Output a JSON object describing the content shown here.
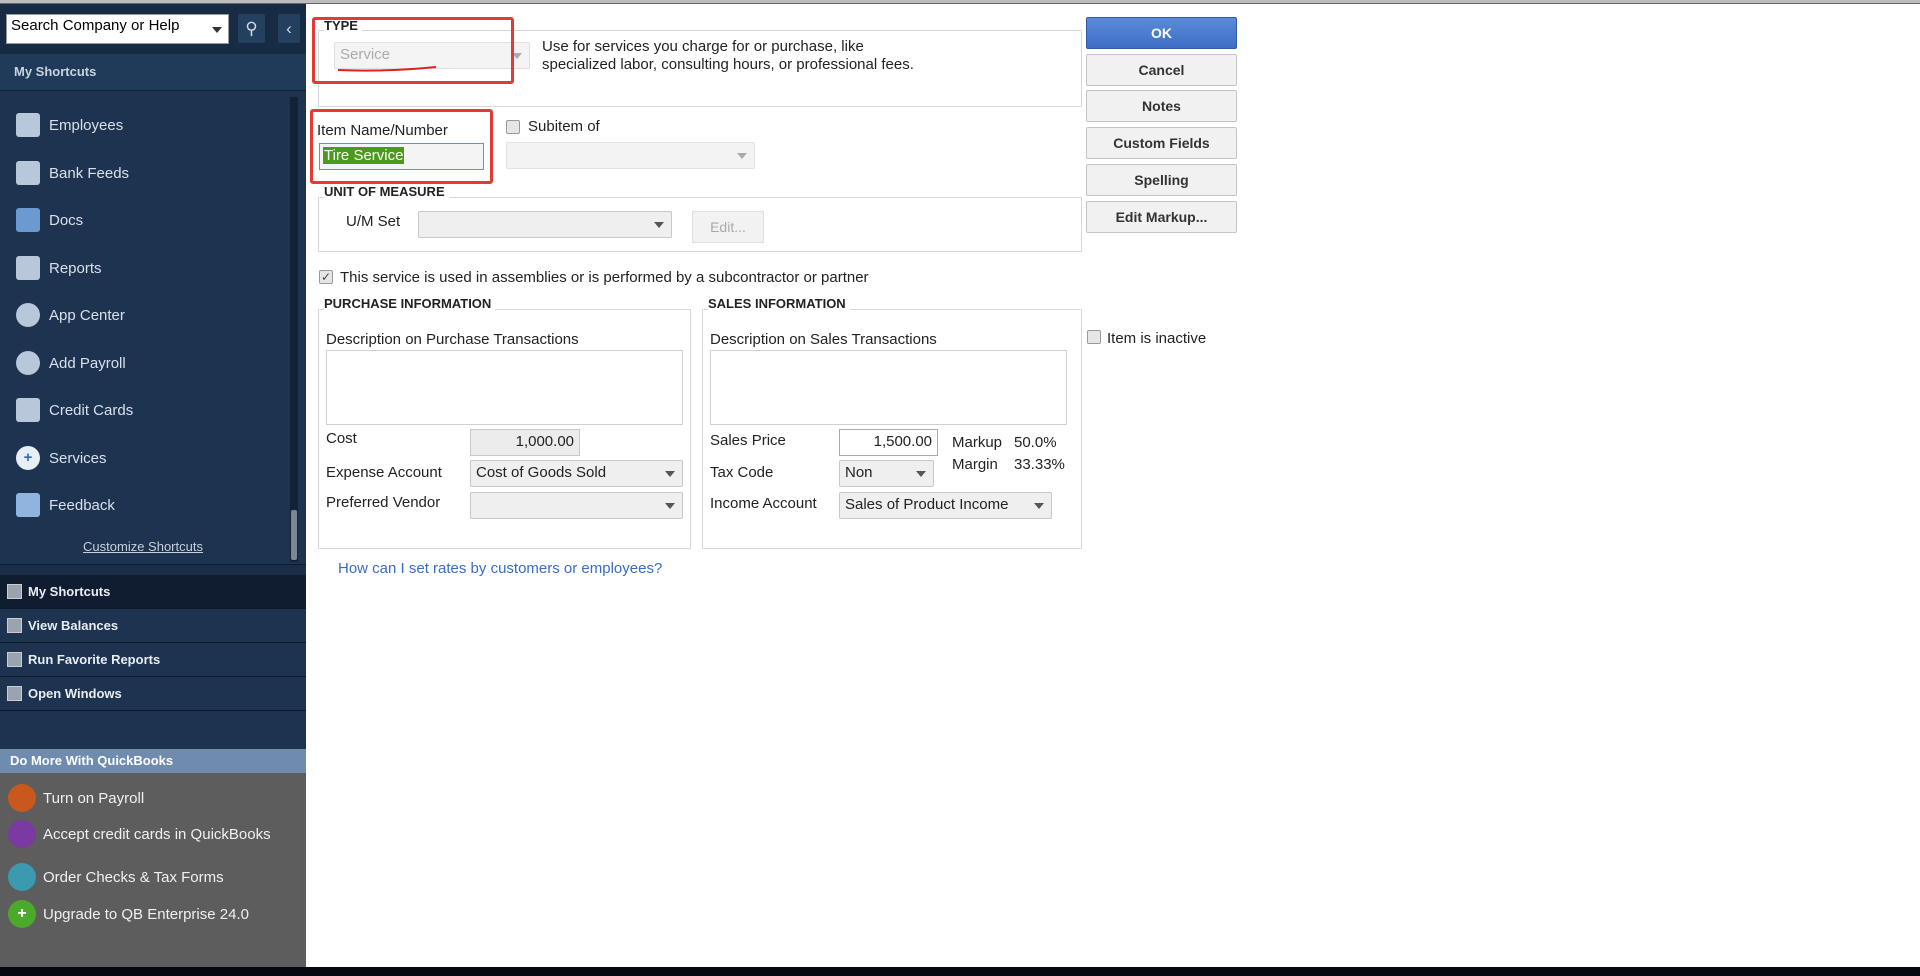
{
  "sidebar": {
    "search_placeholder": "Search Company or Help",
    "header": "My Shortcuts",
    "items": [
      {
        "label": "Employees"
      },
      {
        "label": "Bank Feeds"
      },
      {
        "label": "Docs"
      },
      {
        "label": "Reports"
      },
      {
        "label": "App Center"
      },
      {
        "label": "Add Payroll"
      },
      {
        "label": "Credit Cards"
      },
      {
        "label": "Services"
      },
      {
        "label": "Feedback"
      }
    ],
    "customize": "Customize Shortcuts",
    "nav": [
      {
        "label": "My Shortcuts"
      },
      {
        "label": "View Balances"
      },
      {
        "label": "Run Favorite Reports"
      },
      {
        "label": "Open Windows"
      }
    ],
    "do_more": {
      "header": "Do More With QuickBooks",
      "items": [
        {
          "label": "Turn on Payroll",
          "color": "#c8581e"
        },
        {
          "label": "Accept credit cards in QuickBooks",
          "color": "#7a3aa0"
        },
        {
          "label": "Order Checks & Tax Forms",
          "color": "#3a9ab0"
        },
        {
          "label": "Upgrade to QB Enterprise 24.0",
          "color": "#4caa2a"
        }
      ]
    }
  },
  "form": {
    "type_label": "TYPE",
    "type_value": "Service",
    "type_desc_1": "Use for services you charge for or purchase, like",
    "type_desc_2": "specialized labor, consulting hours, or professional fees.",
    "item_name_label": "Item Name/Number",
    "item_name_value": "Tire Service",
    "subitem_label": "Subitem of",
    "uom_label": "UNIT OF MEASURE",
    "uom_set_label": "U/M Set",
    "edit_label": "Edit...",
    "assembly_label": "This service is used in assemblies or is performed by a subcontractor or partner",
    "purchase": {
      "header": "PURCHASE INFORMATION",
      "desc_label": "Description on Purchase Transactions",
      "cost_label": "Cost",
      "cost_value": "1,000.00",
      "expense_label": "Expense Account",
      "expense_value": "Cost of Goods Sold",
      "vendor_label": "Preferred Vendor"
    },
    "sales": {
      "header": "SALES INFORMATION",
      "desc_label": "Description on Sales Transactions",
      "price_label": "Sales Price",
      "price_value": "1,500.00",
      "markup_label": "Markup",
      "markup_value": "50.0%",
      "margin_label": "Margin",
      "margin_value": "33.33%",
      "tax_label": "Tax Code",
      "tax_value": "Non",
      "income_label": "Income Account",
      "income_value": "Sales of Product Income"
    },
    "inactive_label": "Item is inactive",
    "help_link": "How can I set rates by customers or employees?"
  },
  "buttons": {
    "ok": "OK",
    "cancel": "Cancel",
    "notes": "Notes",
    "custom_fields": "Custom Fields",
    "spelling": "Spelling",
    "edit_markup": "Edit Markup..."
  }
}
